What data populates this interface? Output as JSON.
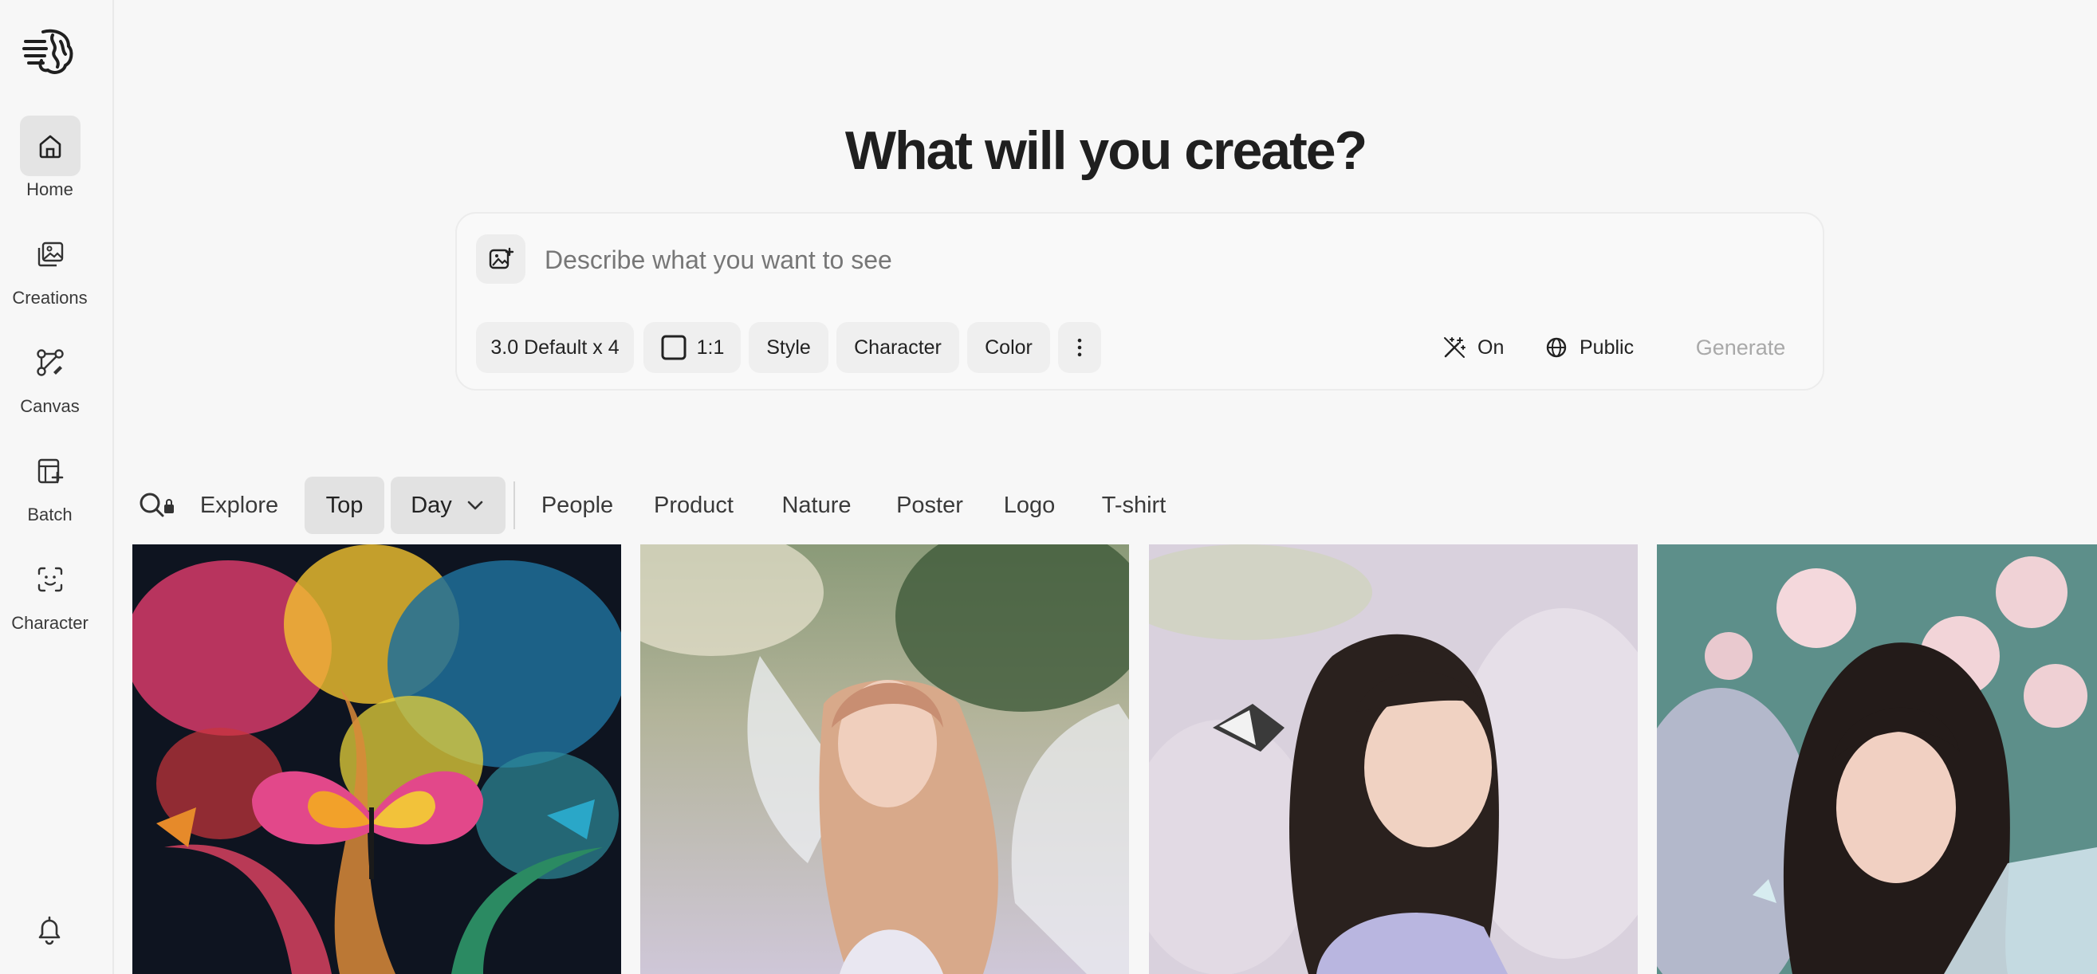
{
  "sidebar": {
    "items": [
      {
        "label": "Home",
        "icon": "home-icon",
        "active": true
      },
      {
        "label": "Creations",
        "icon": "images-icon",
        "active": false
      },
      {
        "label": "Canvas",
        "icon": "canvas-icon",
        "active": false
      },
      {
        "label": "Batch",
        "icon": "batch-icon",
        "active": false
      },
      {
        "label": "Character",
        "icon": "character-icon",
        "active": false
      }
    ],
    "bottom_icon": "bell-icon"
  },
  "main": {
    "title": "What will you create?",
    "prompt": {
      "placeholder": "Describe what you want to see",
      "value": "",
      "model_chip": "3.0 Default x 4",
      "ratio_chip": "1:1",
      "style_chip": "Style",
      "character_chip": "Character",
      "color_chip": "Color",
      "magic_prompt": "On",
      "visibility": "Public",
      "generate_label": "Generate"
    },
    "filters": {
      "explore": "Explore",
      "sort": "Top",
      "period": "Day",
      "categories": [
        "People",
        "Product",
        "Nature",
        "Poster",
        "Logo",
        "T-shirt"
      ]
    },
    "gallery": [
      {
        "subject": "colorful butterfly art"
      },
      {
        "subject": "fairy with wings"
      },
      {
        "subject": "woman with butterfly"
      },
      {
        "subject": "woman among roses"
      }
    ]
  },
  "colors": {
    "background": "#f7f7f7",
    "chip": "#efefef",
    "active_pill": "#e2e2e2",
    "generate_disabled": "#a9a9a9"
  }
}
